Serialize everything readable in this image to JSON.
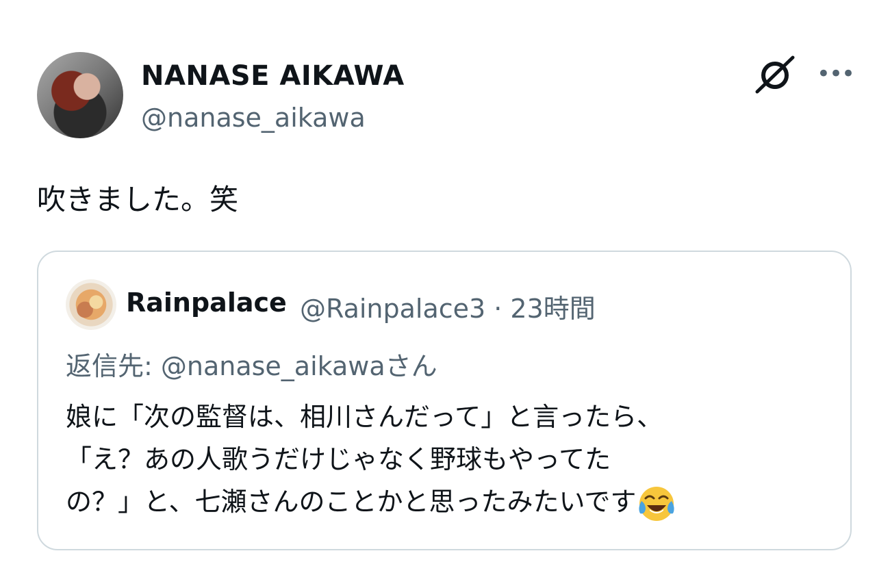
{
  "author": {
    "display_name": "NANASE AIKAWA",
    "handle": "@nanase_aikawa"
  },
  "tweet": {
    "text": "吹きました。笑"
  },
  "actions": {
    "grok_icon": "grok-icon",
    "more_icon": "more-horizontal-icon",
    "more_label": "•••"
  },
  "quote": {
    "author_name": "Rainpalace",
    "meta": "@Rainpalace3 · 23時間",
    "reply_prefix": "返信先: ",
    "reply_mention": "@nanase_aikawaさん",
    "body_lines": [
      "娘に「次の監督は、相川さんだって」と言ったら、",
      "「え？あの人歌うだけじゃなく野球もやってた",
      "の？」と、七瀬さんのことかと思ったみたいです"
    ],
    "emoji": "face-with-tears-of-joy"
  },
  "colors": {
    "text": "#0f1419",
    "secondary": "#536471",
    "border": "#cfd9de"
  }
}
